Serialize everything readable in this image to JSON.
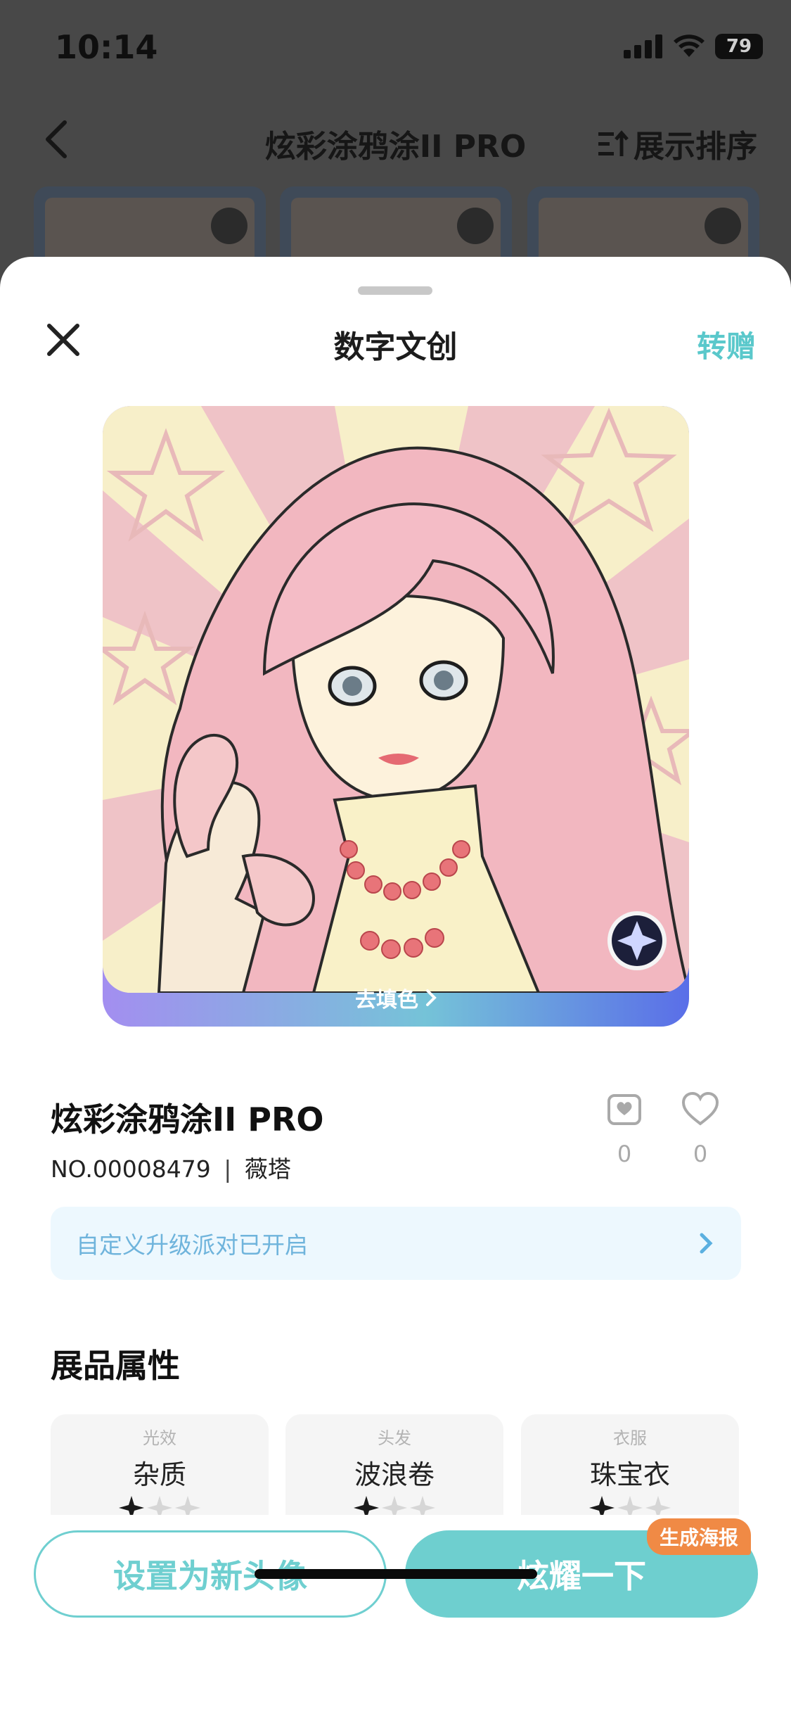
{
  "status_bar": {
    "time": "10:14",
    "battery": "79"
  },
  "background_page": {
    "title": "炫彩涂鸦涂II PRO",
    "sort_label": "展示排序"
  },
  "sheet": {
    "title": "数字文创",
    "gift_label": "转赠"
  },
  "artwork": {
    "fill_button_label": "去填色"
  },
  "item": {
    "name": "炫彩涂鸦涂II PRO",
    "number": "NO.00008479",
    "owner": "薇塔",
    "collect_count": "0",
    "like_count": "0"
  },
  "banner": {
    "text": "自定义升级派对已开启"
  },
  "attributes": {
    "section_title": "展品属性",
    "items": [
      {
        "key": "光效",
        "value": "杂质",
        "stars_filled": 1,
        "stars_total": 3
      },
      {
        "key": "头发",
        "value": "波浪卷",
        "stars_filled": 1,
        "stars_total": 3
      },
      {
        "key": "衣服",
        "value": "珠宝衣",
        "stars_filled": 1,
        "stars_total": 3
      }
    ]
  },
  "actions": {
    "set_avatar_label": "设置为新头像",
    "share_label": "炫耀一下",
    "poster_badge": "生成海报"
  },
  "colors": {
    "accent": "#6ecfcf",
    "banner_text": "#6fb4dc",
    "badge": "#f08a45",
    "fill_gradient_start": "#a38ef0",
    "fill_gradient_end": "#5a6ee8"
  }
}
